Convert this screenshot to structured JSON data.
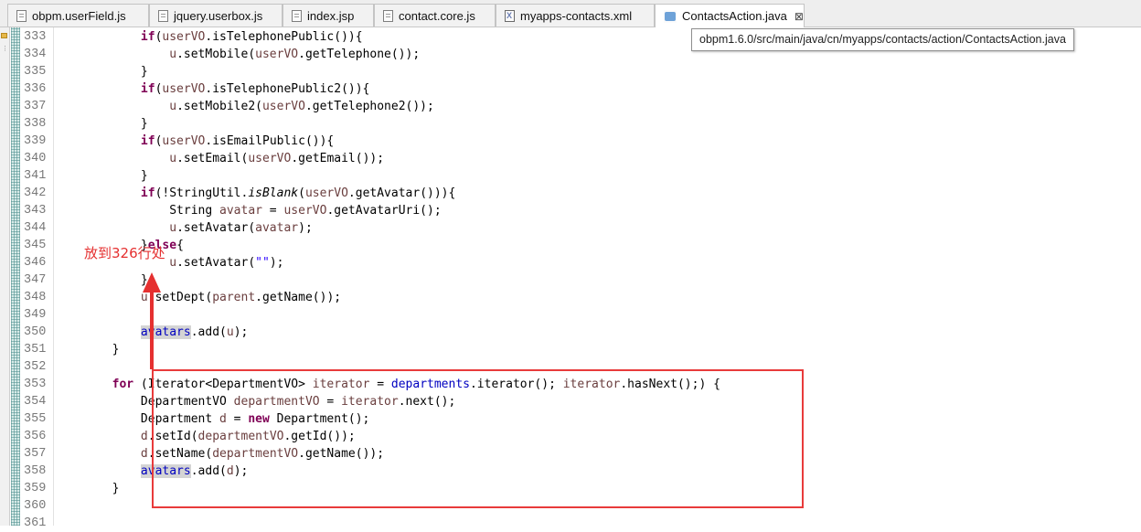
{
  "tabs": [
    {
      "label": "obpm.userField.js",
      "icon": "js-file-icon",
      "active": false
    },
    {
      "label": "jquery.userbox.js",
      "icon": "js-file-icon",
      "active": false
    },
    {
      "label": "index.jsp",
      "icon": "jsp-file-icon",
      "active": false
    },
    {
      "label": "contact.core.js",
      "icon": "js-file-icon",
      "active": false
    },
    {
      "label": "myapps-contacts.xml",
      "icon": "xml-file-icon",
      "active": false
    },
    {
      "label": "ContactsAction.java",
      "icon": "java-file-icon",
      "active": true,
      "close": "⊠"
    }
  ],
  "tooltip": "obpm1.6.0/src/main/java/cn/myapps/contacts/action/ContactsAction.java",
  "editor": {
    "line_numbers": [
      "333",
      "334",
      "335",
      "336",
      "337",
      "338",
      "339",
      "340",
      "341",
      "342",
      "343",
      "344",
      "345",
      "346",
      "347",
      "348",
      "349",
      "350",
      "351",
      "352",
      "353",
      "354",
      "355",
      "356",
      "357",
      "358",
      "359",
      "360",
      "361"
    ],
    "code_lines": [
      "            if(userVO.isTelephonePublic()){",
      "                u.setMobile(userVO.getTelephone());",
      "            }",
      "            if(userVO.isTelephonePublic2()){",
      "                u.setMobile2(userVO.getTelephone2());",
      "            }",
      "            if(userVO.isEmailPublic()){",
      "                u.setEmail(userVO.getEmail());",
      "            }",
      "            if(!StringUtil.isBlank(userVO.getAvatar())){",
      "                String avatar = userVO.getAvatarUri();",
      "                u.setAvatar(avatar);",
      "            }else{",
      "                u.setAvatar(\"\");",
      "            }",
      "            u.setDept(parent.getName());",
      "",
      "            avatars.add(u);",
      "        }",
      "",
      "        for (Iterator<DepartmentVO> iterator = departments.iterator(); iterator.hasNext();) {",
      "            DepartmentVO departmentVO = iterator.next();",
      "            Department d = new Department();",
      "            d.setId(departmentVO.getId());",
      "            d.setName(departmentVO.getName());",
      "            avatars.add(d);",
      "        }",
      "",
      ""
    ]
  },
  "annotation": {
    "label": "放到326行处",
    "color": "#e53030"
  },
  "colors": {
    "keyword": "#7f0055",
    "field": "#0000c0",
    "local_var": "#6a3e3e",
    "string": "#2a00ff",
    "line_number": "#787878"
  }
}
